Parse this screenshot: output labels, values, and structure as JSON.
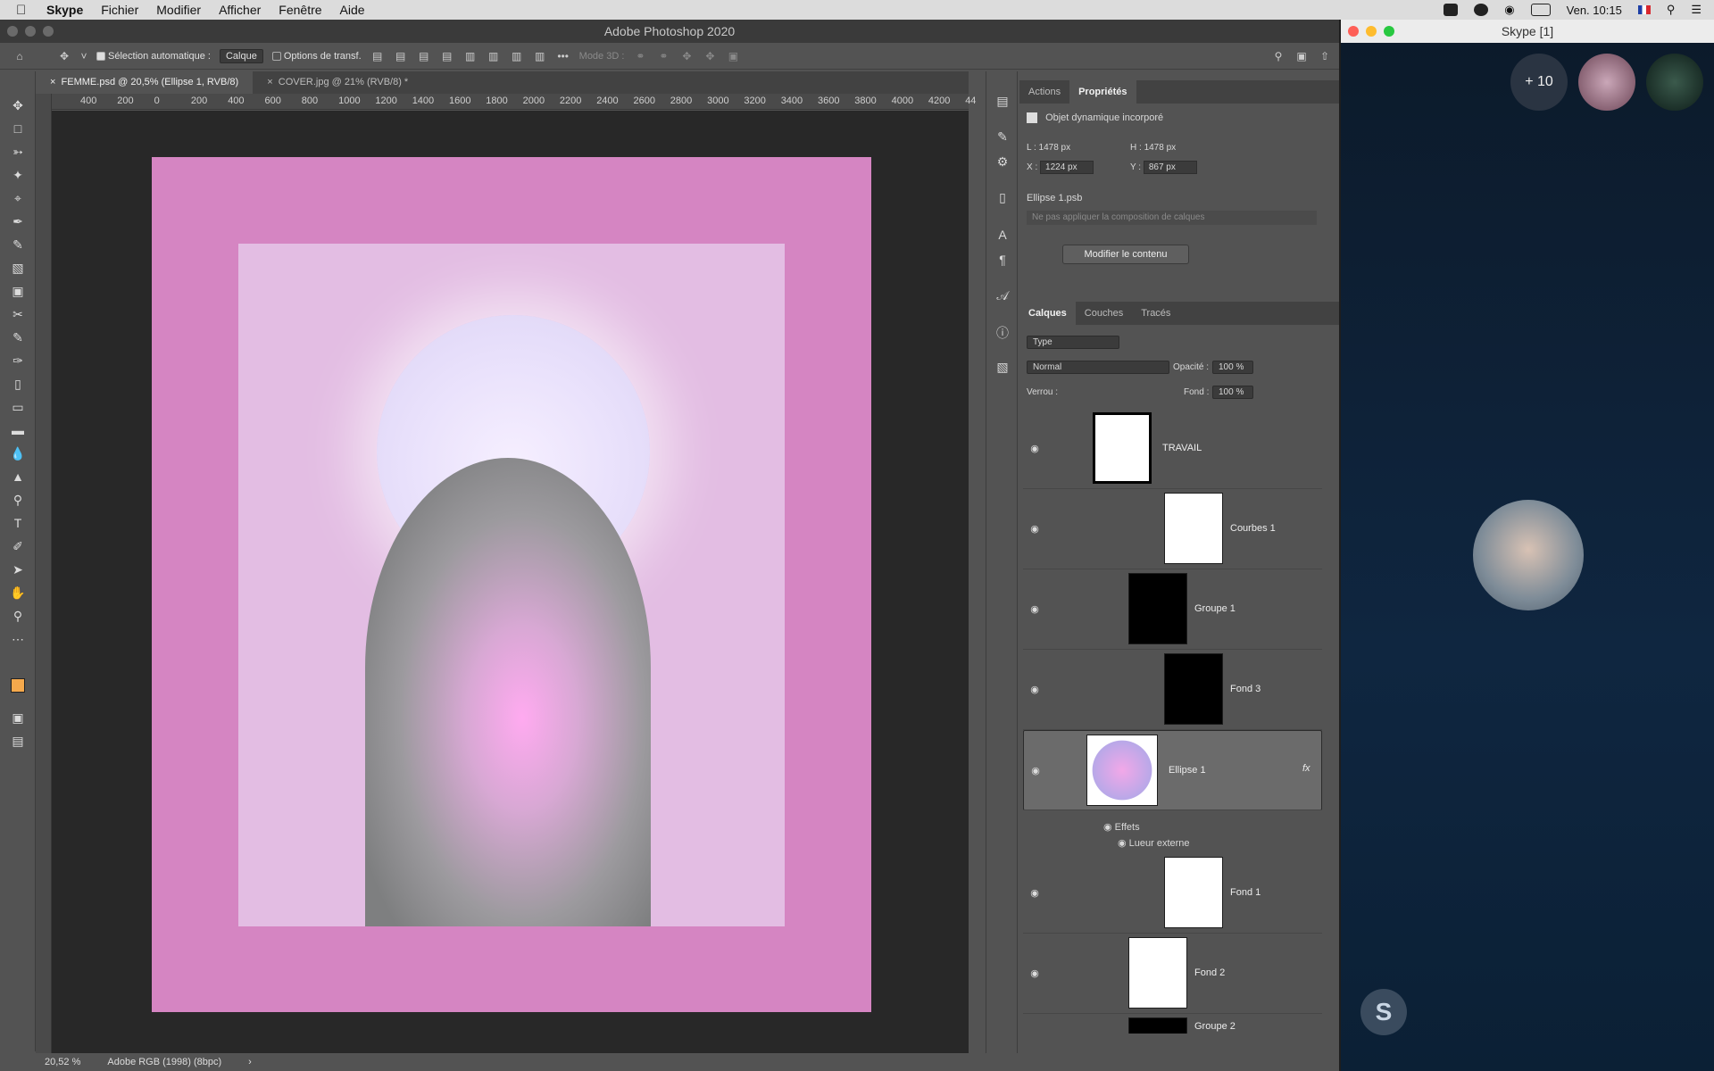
{
  "menubar": {
    "items": [
      "Skype",
      "Fichier",
      "Modifier",
      "Afficher",
      "Fenêtre",
      "Aide"
    ],
    "clock": "Ven. 10:15"
  },
  "photoshop": {
    "window_title": "Adobe Photoshop 2020",
    "options": {
      "auto_select_label": "Sélection automatique :",
      "auto_select_value": "Calque",
      "transform_options": "Options de transf.",
      "mode3d": "Mode 3D :"
    },
    "tabs": [
      {
        "label": "FEMME.psd @ 20,5% (Ellipse 1, RVB/8)"
      },
      {
        "label": "COVER.jpg @ 21% (RVB/8) *"
      }
    ],
    "ruler_labels": [
      "400",
      "200",
      "0",
      "200",
      "400",
      "600",
      "800",
      "1000",
      "1200",
      "1400",
      "1600",
      "1800",
      "2000",
      "2200",
      "2400",
      "2600",
      "2800",
      "3000",
      "3200",
      "3400",
      "3600",
      "3800",
      "4000",
      "4200",
      "44"
    ],
    "status": {
      "zoom": "20,52 %",
      "profile": "Adobe RGB (1998) (8bpc)"
    },
    "properties": {
      "tabs": [
        "Actions",
        "Propriétés"
      ],
      "object_type": "Objet dynamique incorporé",
      "w_label": "L :",
      "w_value": "1478 px",
      "h_label": "H :",
      "h_value": "1478 px",
      "x_label": "X :",
      "x_value": "1224 px",
      "y_label": "Y :",
      "y_value": "867 px",
      "file": "Ellipse 1.psb",
      "comp_placeholder": "Ne pas appliquer la composition de calques",
      "edit_button": "Modifier le contenu"
    },
    "layers_panel": {
      "tabs": [
        "Calques",
        "Couches",
        "Tracés"
      ],
      "filter": "Type",
      "blend_mode": "Normal",
      "opacity_label": "Opacité :",
      "opacity_value": "100 %",
      "lock_label": "Verrou :",
      "fill_label": "Fond :",
      "fill_value": "100 %",
      "layers": [
        {
          "name": "TRAVAIL"
        },
        {
          "name": "Courbes 1"
        },
        {
          "name": "Groupe 1"
        },
        {
          "name": "Fond 3"
        },
        {
          "name": "Ellipse 1"
        },
        {
          "name": "Fond 1"
        },
        {
          "name": "Fond 2"
        },
        {
          "name": "Groupe 2"
        }
      ],
      "effects_label": "Effets",
      "effect_name": "Lueur externe",
      "fx_label": "fx"
    },
    "colors": {
      "canvas_pink": "#d585c2",
      "paper": "#e3bde3",
      "foreground": "#f5a94c",
      "background": "#cdeacd"
    }
  },
  "skype": {
    "window_title": "Skype [1]",
    "more_participants": "+ 10",
    "logo_letter": "S"
  }
}
